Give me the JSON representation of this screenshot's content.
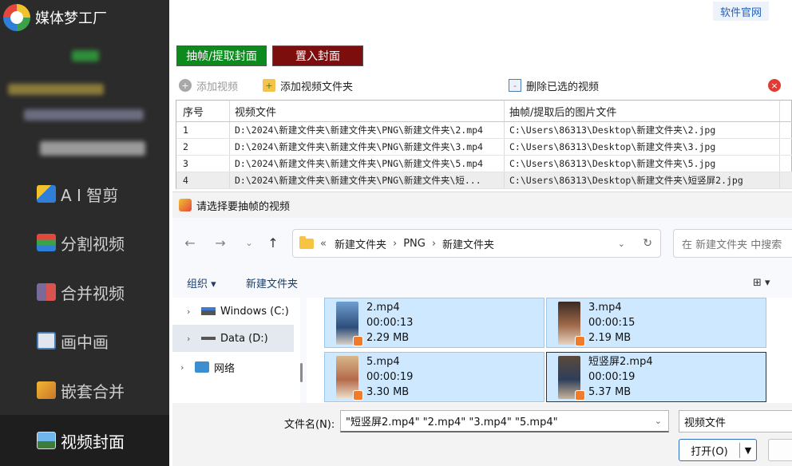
{
  "sidebar": {
    "app_name": "媒体梦工厂",
    "items": [
      {
        "label": "A I 智剪",
        "icon": "ai-scissors-icon"
      },
      {
        "label": "分割视频",
        "icon": "split-video-icon"
      },
      {
        "label": "合并视频",
        "icon": "merge-video-icon"
      },
      {
        "label": "画中画",
        "icon": "picture-in-picture-icon"
      },
      {
        "label": "嵌套合并",
        "icon": "nested-merge-icon"
      },
      {
        "label": "视频封面",
        "icon": "video-cover-icon",
        "active": true
      }
    ]
  },
  "header": {
    "site_link": "软件官网",
    "tabs": [
      {
        "label": "抽帧/提取封面",
        "color": "#0c8a1d"
      },
      {
        "label": "置入封面",
        "color": "#7d0e0e"
      }
    ]
  },
  "toolbar": {
    "add_video": "添加视频",
    "add_folder": "添加视频文件夹",
    "delete_selected": "删除已选的视频"
  },
  "table": {
    "columns": [
      "序号",
      "视频文件",
      "抽帧/提取后的图片文件"
    ],
    "rows": [
      {
        "no": "1",
        "video": "D:\\2024\\新建文件夹\\新建文件夹\\PNG\\新建文件夹\\2.mp4",
        "image": "C:\\Users\\86313\\Desktop\\新建文件夹\\2.jpg"
      },
      {
        "no": "2",
        "video": "D:\\2024\\新建文件夹\\新建文件夹\\PNG\\新建文件夹\\3.mp4",
        "image": "C:\\Users\\86313\\Desktop\\新建文件夹\\3.jpg"
      },
      {
        "no": "3",
        "video": "D:\\2024\\新建文件夹\\新建文件夹\\PNG\\新建文件夹\\5.mp4",
        "image": "C:\\Users\\86313\\Desktop\\新建文件夹\\5.jpg"
      },
      {
        "no": "4",
        "video": "D:\\2024\\新建文件夹\\新建文件夹\\PNG\\新建文件夹\\短...",
        "image": "C:\\Users\\86313\\Desktop\\新建文件夹\\短竖屏2.jpg"
      }
    ]
  },
  "dialog": {
    "title": "请选择要抽帧的视频",
    "breadcrumb": {
      "overflow": "«",
      "parts": [
        "新建文件夹",
        "PNG",
        "新建文件夹"
      ]
    },
    "search_placeholder": "在 新建文件夹 中搜索",
    "commands": {
      "organize": "组织 ▾",
      "new_folder": "新建文件夹"
    },
    "tree": [
      {
        "label": "Windows (C:)"
      },
      {
        "label": "Data (D:)",
        "selected": true
      },
      {
        "label": "网络"
      }
    ],
    "files": [
      {
        "name": "2.mp4",
        "duration": "00:00:13",
        "size": "2.29 MB"
      },
      {
        "name": "3.mp4",
        "duration": "00:00:15",
        "size": "2.19 MB"
      },
      {
        "name": "5.mp4",
        "duration": "00:00:19",
        "size": "3.30 MB"
      },
      {
        "name": "短竖屏2.mp4",
        "duration": "00:00:19",
        "size": "5.37 MB"
      }
    ],
    "filename_label": "文件名(N):",
    "filename_value": "\"短竖屏2.mp4\" \"2.mp4\" \"3.mp4\" \"5.mp4\"",
    "filetype": "视频文件",
    "open_label": "打开(O)"
  }
}
